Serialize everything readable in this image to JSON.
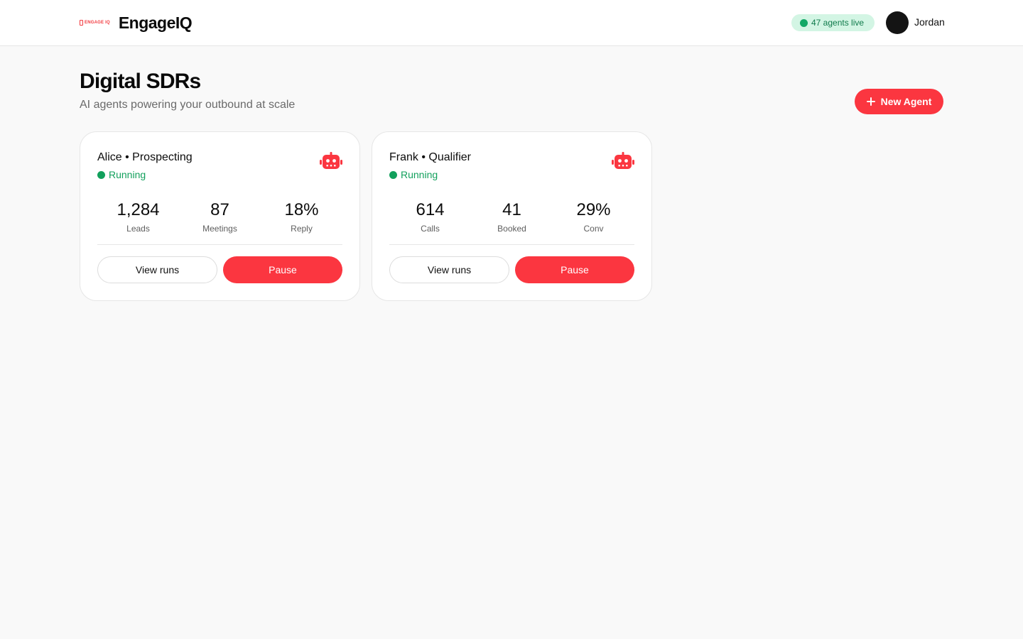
{
  "header": {
    "brand_mark_text": "ENGAGE IQ",
    "brand_name": "EngageIQ",
    "live_badge": "47 agents live",
    "user_name": "Jordan"
  },
  "page": {
    "title": "Digital SDRs",
    "subtitle": "AI agents powering your outbound at scale",
    "new_agent_label": "New Agent"
  },
  "agents": [
    {
      "title": "Alice • Prospecting",
      "status": "Running",
      "stats": [
        {
          "value": "1,284",
          "label": "Leads"
        },
        {
          "value": "87",
          "label": "Meetings"
        },
        {
          "value": "18%",
          "label": "Reply"
        }
      ],
      "view_label": "View runs",
      "pause_label": "Pause"
    },
    {
      "title": "Frank • Qualifier",
      "status": "Running",
      "stats": [
        {
          "value": "614",
          "label": "Calls"
        },
        {
          "value": "41",
          "label": "Booked"
        },
        {
          "value": "29%",
          "label": "Conv"
        }
      ],
      "view_label": "View runs",
      "pause_label": "Pause"
    }
  ],
  "colors": {
    "accent": "#fb3640",
    "status_green": "#12a05c",
    "live_badge_bg": "#d3f5e4"
  },
  "icons": {
    "agent_icon": "robot-icon",
    "new_agent_icon": "plus-icon",
    "status_icon": "status-dot"
  }
}
